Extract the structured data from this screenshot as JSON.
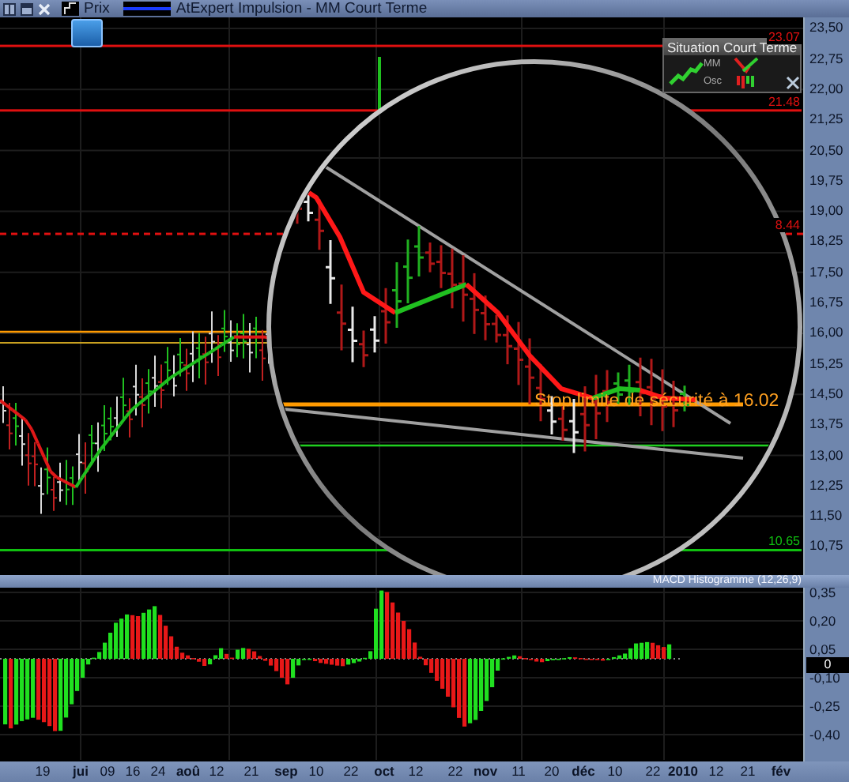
{
  "title_bar": {
    "price_label": "Prix",
    "indicator_label": "AtExpert Impulsion - MM Court Terme"
  },
  "price_chart": {
    "y_axis": [
      "23,50",
      "22,75",
      "22,00",
      "21,25",
      "20,50",
      "19,75",
      "19,00",
      "18,25",
      "17,50",
      "16,75",
      "16,00",
      "15,25",
      "14,50",
      "13,75",
      "13,00",
      "12,25",
      "11,50",
      "10,75"
    ],
    "level_lines": [
      {
        "label": "23.07",
        "color": "#e01010",
        "kind": "solid"
      },
      {
        "label": "21.48",
        "color": "#e01010",
        "kind": "solid"
      },
      {
        "label": "8.44",
        "color": "#e01010",
        "kind": "dashed"
      },
      {
        "label": "10.65",
        "color": "#10c010",
        "kind": "solid"
      }
    ],
    "annotation": "Stop limite de sécurité à 16.02"
  },
  "situation_panel": {
    "title": "Situation Court Terme",
    "rows": [
      "MM",
      "Osc"
    ]
  },
  "macd": {
    "title": "MACD Histogramme (12,26,9)",
    "y_axis": [
      "0,35",
      "0,20",
      "0,05",
      "-0,10",
      "-0,25",
      "-0,40"
    ],
    "cursor_value": "0"
  },
  "x_axis": [
    {
      "label": "19",
      "kind": "day"
    },
    {
      "label": "jui",
      "kind": "month"
    },
    {
      "label": "09",
      "kind": "day"
    },
    {
      "label": "16",
      "kind": "day"
    },
    {
      "label": "24",
      "kind": "day"
    },
    {
      "label": "aoû",
      "kind": "month"
    },
    {
      "label": "12",
      "kind": "day"
    },
    {
      "label": "21",
      "kind": "day"
    },
    {
      "label": "sep",
      "kind": "month"
    },
    {
      "label": "10",
      "kind": "day"
    },
    {
      "label": "22",
      "kind": "day"
    },
    {
      "label": "oct",
      "kind": "month"
    },
    {
      "label": "12",
      "kind": "day"
    },
    {
      "label": "22",
      "kind": "day"
    },
    {
      "label": "nov",
      "kind": "month"
    },
    {
      "label": "11",
      "kind": "day"
    },
    {
      "label": "20",
      "kind": "day"
    },
    {
      "label": "déc",
      "kind": "month"
    },
    {
      "label": "10",
      "kind": "day"
    },
    {
      "label": "22",
      "kind": "day"
    },
    {
      "label": "2010",
      "kind": "month"
    },
    {
      "label": "12",
      "kind": "day"
    },
    {
      "label": "21",
      "kind": "day"
    },
    {
      "label": "fév",
      "kind": "month"
    }
  ]
}
